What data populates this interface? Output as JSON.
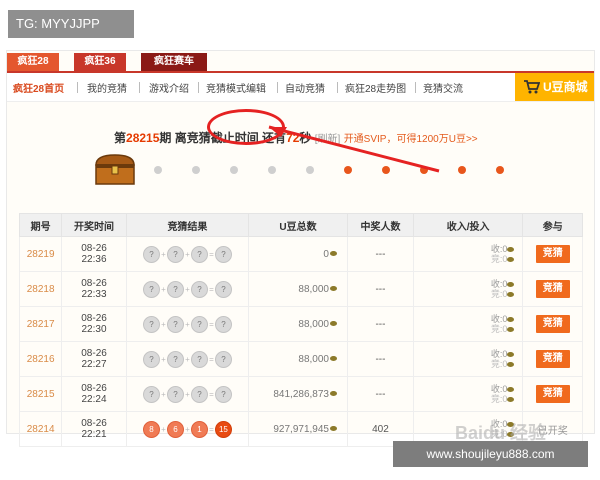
{
  "overlay": {
    "tag": "TG: MYYJJPP",
    "watermark": "www.shoujileyu888.com",
    "baidu_mark": "Baidu 经验"
  },
  "top_tabs": [
    {
      "label": "疯狂28",
      "color": "#e4572e"
    },
    {
      "label": "疯狂36",
      "color": "#c8372a"
    },
    {
      "label": "疯狂赛车",
      "color": "#8b1a16"
    }
  ],
  "nav": {
    "items": [
      "疯狂28首页",
      "我的竞猜",
      "游戏介绍",
      "竞猜模式编辑",
      "自动竞猜",
      "疯狂28走势图",
      "竞猜交流"
    ],
    "shop_label": "U豆商城"
  },
  "headline": {
    "prefix": "第",
    "period": "28215",
    "middle": "期 离竞猜截止时间 还有",
    "seconds": "72",
    "unit": "秒",
    "refresh": "[刷新]",
    "svip": "开通SVIP，可得1200万U豆>>"
  },
  "progress": {
    "total_dots": 10,
    "active_from": 5
  },
  "table": {
    "headers": [
      "期号",
      "开奖时间",
      "竞猜结果",
      "U豆总数",
      "中奖人数",
      "收入/投入",
      "参与"
    ],
    "rows": [
      {
        "issue": "28219",
        "date": "08-26",
        "time": "22:36",
        "balls": [
          "?",
          "?",
          "?",
          "?"
        ],
        "revealed": false,
        "pool": "0",
        "winners": "---",
        "income": "收:0",
        "invest": "竞:0",
        "action": "竞猜"
      },
      {
        "issue": "28218",
        "date": "08-26",
        "time": "22:33",
        "balls": [
          "?",
          "?",
          "?",
          "?"
        ],
        "revealed": false,
        "pool": "88,000",
        "winners": "---",
        "income": "收:0",
        "invest": "竞:0",
        "action": "竞猜"
      },
      {
        "issue": "28217",
        "date": "08-26",
        "time": "22:30",
        "balls": [
          "?",
          "?",
          "?",
          "?"
        ],
        "revealed": false,
        "pool": "88,000",
        "winners": "---",
        "income": "收:0",
        "invest": "竞:0",
        "action": "竞猜"
      },
      {
        "issue": "28216",
        "date": "08-26",
        "time": "22:27",
        "balls": [
          "?",
          "?",
          "?",
          "?"
        ],
        "revealed": false,
        "pool": "88,000",
        "winners": "---",
        "income": "收:0",
        "invest": "竞:0",
        "action": "竞猜"
      },
      {
        "issue": "28215",
        "date": "08-26",
        "time": "22:24",
        "balls": [
          "?",
          "?",
          "?",
          "?"
        ],
        "revealed": false,
        "pool": "841,286,873",
        "winners": "---",
        "income": "收:0",
        "invest": "竞:0",
        "action": "竞猜"
      },
      {
        "issue": "28214",
        "date": "08-26",
        "time": "22:21",
        "balls": [
          "8",
          "6",
          "1",
          "15"
        ],
        "revealed": true,
        "pool": "927,971,945",
        "winners": "402",
        "income": "收:0",
        "invest": "竞:0",
        "action": "已开奖"
      }
    ]
  },
  "colors": {
    "accent": "#e84b12",
    "shop": "#ffb400",
    "annotation": "#e52222"
  }
}
